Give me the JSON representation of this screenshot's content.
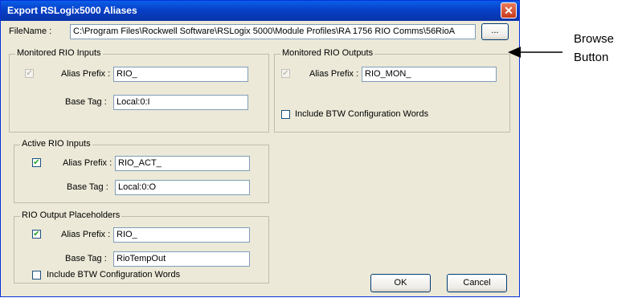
{
  "window": {
    "title": "Export RSLogix5000 Aliases",
    "close_glyph": "✕"
  },
  "filename": {
    "label": "FileName :",
    "value": "C:\\Program Files\\Rockwell Software\\RSLogix 5000\\Module Profiles\\RA 1756 RIO Comms\\56RioA",
    "browse_label": "..."
  },
  "monitored_inputs": {
    "title": "Monitored RIO Inputs",
    "checked": true,
    "check_glyph": "✔",
    "alias_prefix_label": "Alias Prefix :",
    "alias_prefix_value": "RIO_",
    "base_tag_label": "Base Tag :",
    "base_tag_value": "Local:0:I"
  },
  "monitored_outputs": {
    "title": "Monitored RIO Outputs",
    "checked": true,
    "check_glyph": "✔",
    "alias_prefix_label": "Alias Prefix :",
    "alias_prefix_value": "RIO_MON_",
    "btw_label": "Include BTW Configuration Words",
    "btw_checked": false
  },
  "active_inputs": {
    "title": "Active RIO Inputs",
    "checked": true,
    "check_glyph": "✔",
    "alias_prefix_label": "Alias Prefix :",
    "alias_prefix_value": "RIO_ACT_",
    "base_tag_label": "Base Tag :",
    "base_tag_value": "Local:0:O"
  },
  "output_placeholders": {
    "title": "RIO Output Placeholders",
    "checked": true,
    "check_glyph": "✔",
    "alias_prefix_label": "Alias Prefix :",
    "alias_prefix_value": "RIO_",
    "base_tag_label": "Base Tag :",
    "base_tag_value": "RioTempOut",
    "btw_label": "Include BTW Configuration Words",
    "btw_checked": false
  },
  "buttons": {
    "ok": "OK",
    "cancel": "Cancel"
  },
  "annotation": {
    "line1": "Browse",
    "line2": "Button"
  },
  "colors": {
    "title_bar": "#0840c8",
    "dialog_bg": "#ece9d8",
    "check": "#21a121"
  }
}
